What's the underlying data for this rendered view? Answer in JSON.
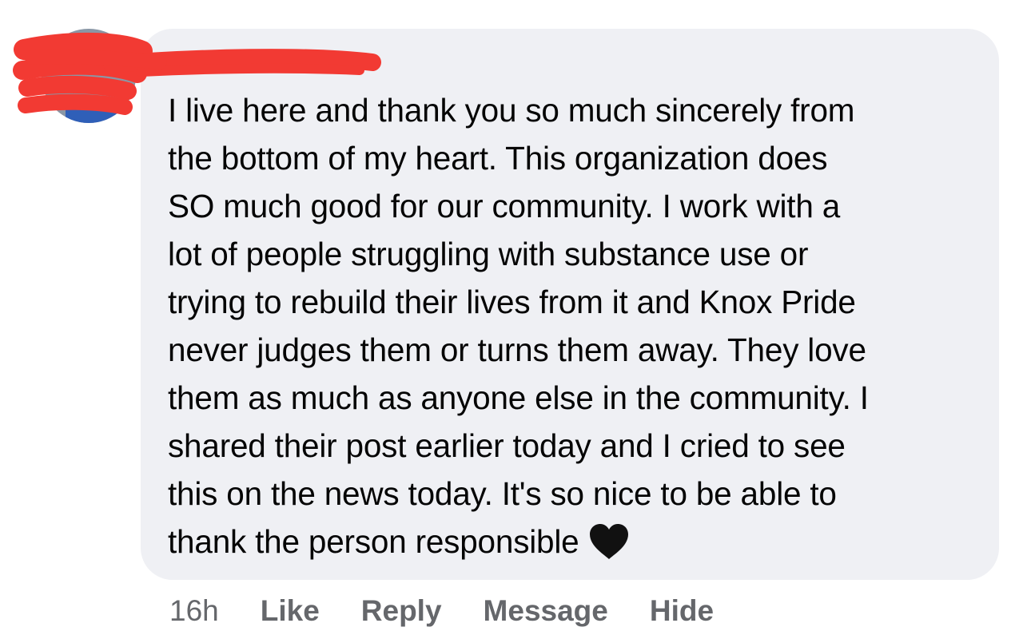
{
  "comment": {
    "author_name": "",
    "lines": [
      "I live here and thank you so much sincerely from",
      "the bottom of my heart. This organization does",
      "SO much good for our community. I work with a",
      "lot of people struggling with substance use or",
      "trying to rebuild their lives from it and Knox Pride",
      "never judges them or turns them away. They love",
      "them as much as anyone else in the community. I",
      "shared their post earlier today and I cried to see",
      "this on the news today. It's so nice to be able to",
      "thank the person responsible"
    ],
    "emoji": "black-heart-icon"
  },
  "actions": {
    "timestamp": "16h",
    "like_label": "Like",
    "reply_label": "Reply",
    "message_label": "Message",
    "hide_label": "Hide"
  },
  "colors": {
    "bubble": "#eff0f4",
    "text": "#050505",
    "secondary": "#65676b",
    "redaction": "#f23a33"
  }
}
